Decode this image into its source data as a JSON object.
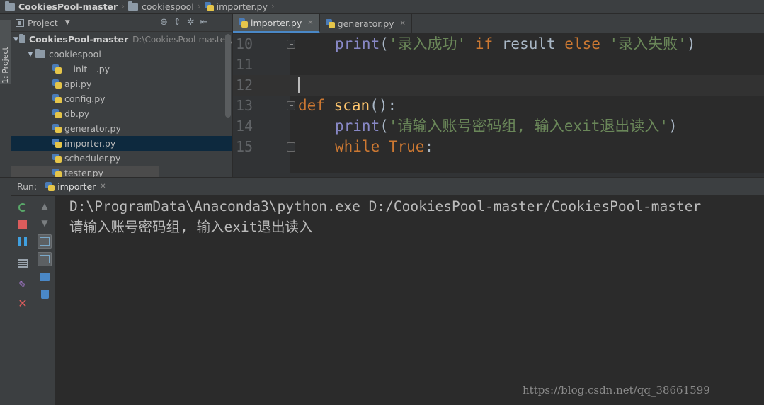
{
  "breadcrumb": {
    "project": "CookiesPool-master",
    "folder": "cookiespool",
    "file": "importer.py"
  },
  "left_strip": {
    "project_tab": "1: Project"
  },
  "project_panel": {
    "title": "Project",
    "root_name": "CookiesPool-master",
    "root_path": "D:\\CookiesPool-master\\",
    "folder_name": "cookiespool",
    "files": [
      "__init__.py",
      "api.py",
      "config.py",
      "db.py",
      "generator.py",
      "importer.py",
      "scheduler.py",
      "tester.py"
    ],
    "selected_file": "importer.py"
  },
  "editor": {
    "tabs": [
      {
        "label": "importer.py",
        "active": true
      },
      {
        "label": "generator.py",
        "active": false
      }
    ],
    "line_numbers": [
      "10",
      "11",
      "12",
      "13",
      "14",
      "15"
    ],
    "code": {
      "l10_print": "print",
      "l10_open": "(",
      "l10_str1": "'录入成功'",
      "l10_if": "if",
      "l10_result": "result",
      "l10_else": "else",
      "l10_str2": "'录入失败'",
      "l10_close": ")",
      "l13_def": "def",
      "l13_name": "scan",
      "l13_rest": "():",
      "l14_print": "print",
      "l14_open": "(",
      "l14_str": "'请输入账号密码组, 输入exit退出读入'",
      "l14_close": ")",
      "l15_while": "while",
      "l15_true": "True",
      "l15_colon": ":"
    }
  },
  "run_panel": {
    "label": "Run:",
    "tab_label": "importer",
    "console_lines": [
      "D:\\ProgramData\\Anaconda3\\python.exe D:/CookiesPool-master/CookiesPool-master",
      "请输入账号密码组, 输入exit退出读入"
    ]
  },
  "watermark": "https://blog.csdn.net/qq_38661599",
  "colors": {
    "keyword": "#cc7832",
    "function": "#ffc66d",
    "builtin": "#8888c6",
    "string": "#6a8759",
    "selection": "#0d293e",
    "active_tab_underline": "#4a88c7"
  }
}
